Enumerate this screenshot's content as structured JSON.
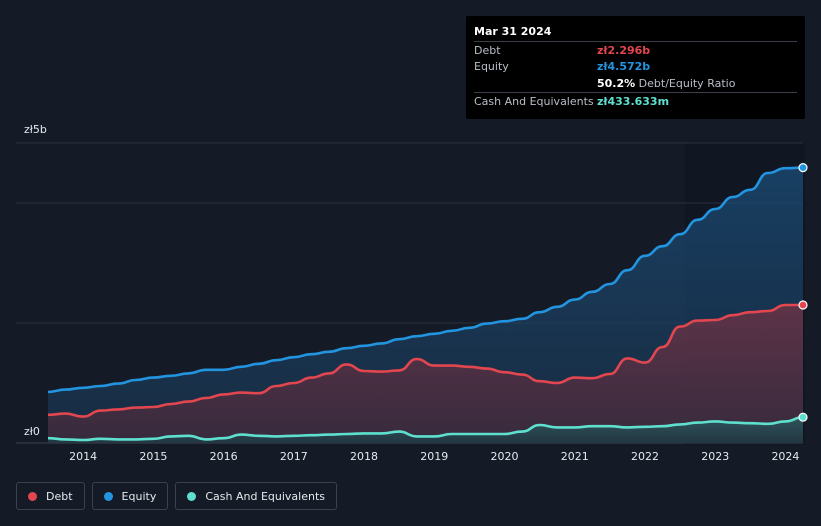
{
  "tooltip": {
    "date": "Mar 31 2024",
    "debt_label": "Debt",
    "debt_value": "zł2.296b",
    "equity_label": "Equity",
    "equity_value": "zł4.572b",
    "ratio_value": "50.2%",
    "ratio_label": "Debt/Equity Ratio",
    "cash_label": "Cash And Equivalents",
    "cash_value": "zł433.633m"
  },
  "legend": {
    "debt": "Debt",
    "equity": "Equity",
    "cash": "Cash And Equivalents"
  },
  "colors": {
    "debt": "#e2464f",
    "equity": "#2394df",
    "cash": "#5fe0cf",
    "background": "#151b26"
  },
  "chart_data": {
    "type": "area",
    "y_unit": "zł billions",
    "ylim": [
      0,
      5
    ],
    "y_tick_labels": [
      "zł0",
      "zł5b"
    ],
    "x_tick_labels": [
      "2014",
      "2015",
      "2016",
      "2017",
      "2018",
      "2019",
      "2020",
      "2021",
      "2022",
      "2023",
      "2024"
    ],
    "x": [
      2013.5,
      2013.75,
      2014.0,
      2014.25,
      2014.5,
      2014.75,
      2015.0,
      2015.25,
      2015.5,
      2015.75,
      2016.0,
      2016.25,
      2016.5,
      2016.75,
      2017.0,
      2017.25,
      2017.5,
      2017.75,
      2018.0,
      2018.25,
      2018.5,
      2018.75,
      2019.0,
      2019.25,
      2019.5,
      2019.75,
      2020.0,
      2020.25,
      2020.5,
      2020.75,
      2021.0,
      2021.25,
      2021.5,
      2021.75,
      2022.0,
      2022.25,
      2022.5,
      2022.75,
      2023.0,
      2023.25,
      2023.5,
      2023.75,
      2024.0,
      2024.25
    ],
    "series": [
      {
        "name": "Equity",
        "values": [
          0.85,
          0.89,
          0.92,
          0.95,
          0.99,
          1.05,
          1.09,
          1.12,
          1.16,
          1.22,
          1.22,
          1.27,
          1.32,
          1.38,
          1.43,
          1.48,
          1.52,
          1.58,
          1.62,
          1.66,
          1.73,
          1.78,
          1.82,
          1.87,
          1.92,
          1.99,
          2.03,
          2.07,
          2.18,
          2.27,
          2.39,
          2.52,
          2.65,
          2.88,
          3.12,
          3.28,
          3.48,
          3.72,
          3.9,
          4.1,
          4.22,
          4.5,
          4.58,
          4.59
        ]
      },
      {
        "name": "Debt",
        "values": [
          0.47,
          0.49,
          0.44,
          0.54,
          0.56,
          0.59,
          0.6,
          0.65,
          0.69,
          0.75,
          0.81,
          0.84,
          0.83,
          0.95,
          1.0,
          1.09,
          1.16,
          1.31,
          1.2,
          1.19,
          1.21,
          1.4,
          1.29,
          1.29,
          1.27,
          1.24,
          1.18,
          1.14,
          1.03,
          1.0,
          1.09,
          1.08,
          1.15,
          1.41,
          1.34,
          1.6,
          1.94,
          2.04,
          2.05,
          2.13,
          2.18,
          2.2,
          2.3,
          2.3
        ]
      },
      {
        "name": "Cash And Equivalents",
        "values": [
          0.08,
          0.06,
          0.05,
          0.07,
          0.06,
          0.06,
          0.07,
          0.11,
          0.12,
          0.06,
          0.08,
          0.14,
          0.12,
          0.11,
          0.12,
          0.13,
          0.14,
          0.15,
          0.16,
          0.16,
          0.19,
          0.11,
          0.11,
          0.15,
          0.15,
          0.15,
          0.15,
          0.19,
          0.3,
          0.26,
          0.26,
          0.28,
          0.28,
          0.26,
          0.27,
          0.28,
          0.31,
          0.34,
          0.36,
          0.34,
          0.33,
          0.32,
          0.36,
          0.43
        ]
      }
    ],
    "grid": true,
    "legend_position": "bottom-left"
  }
}
